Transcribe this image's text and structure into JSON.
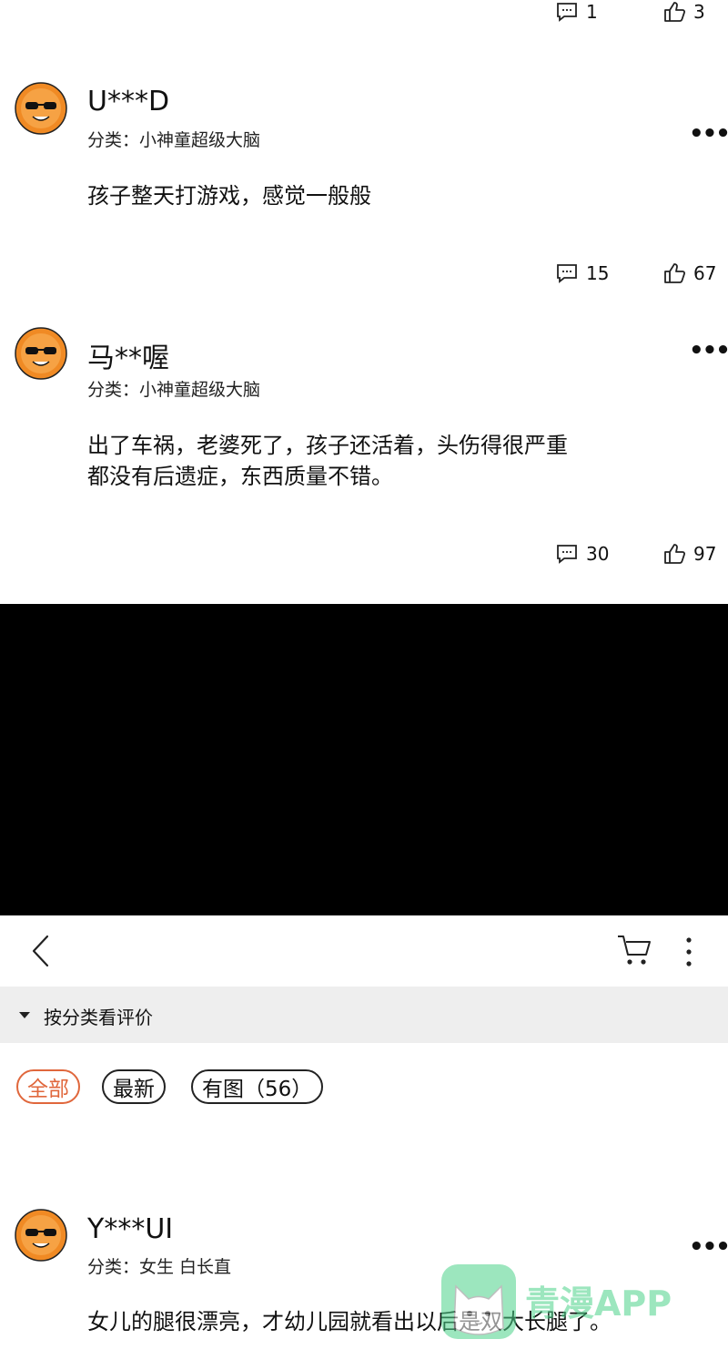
{
  "reviews_top": [
    {
      "comments": "1",
      "likes": "3"
    },
    {
      "username": "U***D",
      "category": "分类：小神童超级大脑",
      "text": [
        "孩子整天打游戏，感觉一般般"
      ],
      "comments": "15",
      "likes": "67"
    },
    {
      "username": "马**喔",
      "category": "分类：小神童超级大脑",
      "text": [
        "出了车祸，老婆死了，孩子还活着，头伤得很严重",
        "都没有后遗症，东西质量不错。"
      ],
      "comments": "30",
      "likes": "97"
    }
  ],
  "header": {
    "back_icon": "chevron-left-icon",
    "cart_icon": "cart-icon",
    "menu_icon": "vertical-ellipsis-icon"
  },
  "filter": {
    "label": "按分类看评价",
    "icon": "caret-down-icon"
  },
  "chips": [
    {
      "label": "全部",
      "active": true
    },
    {
      "label": "最新",
      "active": false
    },
    {
      "label": "有图（56）",
      "active": false
    }
  ],
  "reviews_bottom": [
    {
      "username": "Y***UI",
      "category": "分类：女生  白长直",
      "text": [
        "女儿的腿很漂亮，才幼儿园就看出以后是双大长腿了。"
      ]
    }
  ],
  "watermark": {
    "text": "青漫APP"
  },
  "colors": {
    "accent": "#e0673c",
    "avatar": "#f08a24",
    "panel": "#000000",
    "filter_bg": "#eeeeee"
  }
}
